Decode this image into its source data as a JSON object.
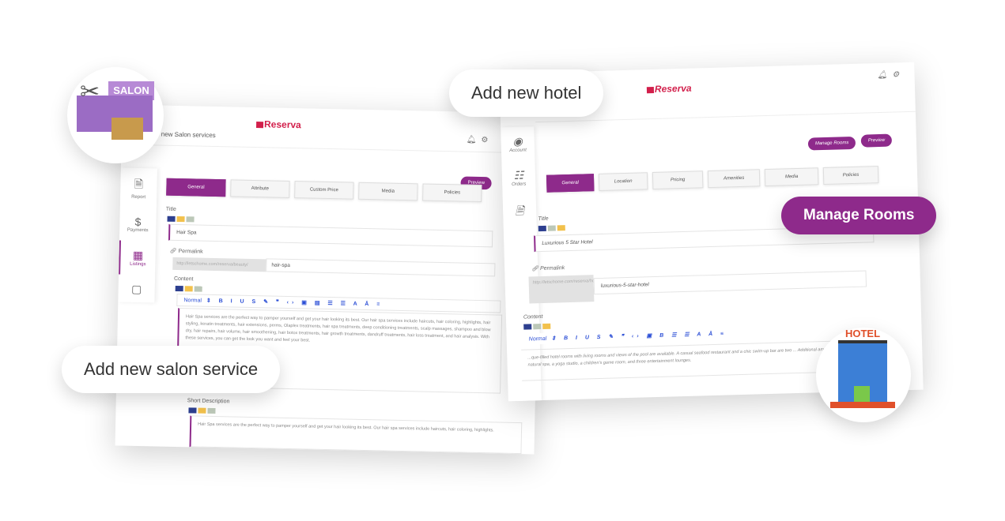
{
  "brand": {
    "name": "Reserva",
    "accent": "#8e2a8b",
    "logo_color": "#d21f4b"
  },
  "salon": {
    "page_title": "new Salon services",
    "sidebar": [
      {
        "label": "Report",
        "icon": "report-icon"
      },
      {
        "label": "Payments",
        "icon": "dollar-icon"
      },
      {
        "label": "Listings",
        "icon": "listings-icon"
      }
    ],
    "preview_label": "Preview",
    "tabs": [
      "General",
      "Attribute",
      "Custom Price",
      "Media",
      "Policies"
    ],
    "title_label": "Title",
    "title_value": "Hair Spa",
    "permalink_label": "Permalink",
    "permalink_prefix": "http://letschome.com/reserva/beauty/",
    "permalink_value": "hair-spa",
    "content_label": "Content",
    "toolbar_format": "Normal",
    "content_text": "Hair Spa services are the perfect way to pamper yourself and get your hair looking its best. Our hair spa services include haircuts, hair coloring, highlights, hair styling, keratin treatments, hair extensions, perms, Olaplex treatments, hair spa treatments, deep conditioning treatments, scalp massages, shampoo and blow dry, hair repairs, hair volume, hair smoothening, hair botox treatments, hair growth treatments, dandruff treatments, hair loss treatment, and hair analysis. With these services, you can get the look you want and feel your best.",
    "short_desc_label": "Short Description",
    "short_desc_text": "Hair Spa services are the perfect way to pamper yourself and get your hair looking its best. Our hair spa services include haircuts, hair coloring, highlights."
  },
  "hotel": {
    "sidebar": [
      {
        "label": "Account",
        "icon": "account-icon"
      },
      {
        "label": "Orders",
        "icon": "orders-icon"
      }
    ],
    "manage_rooms_label": "Manage Rooms",
    "preview_label": "Preview",
    "tabs": [
      "General",
      "Location",
      "Pricing",
      "Amenities",
      "Media",
      "Policies"
    ],
    "title_label": "Title",
    "title_value": "Luxurious 5 Star Hotel",
    "permalink_label": "Permalink",
    "permalink_prefix": "http://letschome.com/reserva/hotel/",
    "permalink_value": "luxurious-5-star-hotel",
    "content_label": "Content",
    "toolbar_format": "Normal",
    "content_text": "...que-filled hotel rooms with living rooms and views of the pool are available. A casual seafood restaurant and a chic swim-up bar are two ... Additional amenities include a hot tub, a natural spa, a yoga studio, a children's game room, and three entertainment lounges."
  },
  "callouts": {
    "hotel": "Add new hotel",
    "rooms": "Manage Rooms",
    "salon": "Add new salon service"
  },
  "badges": {
    "salon": "SALON",
    "hotel": "HOTEL"
  }
}
